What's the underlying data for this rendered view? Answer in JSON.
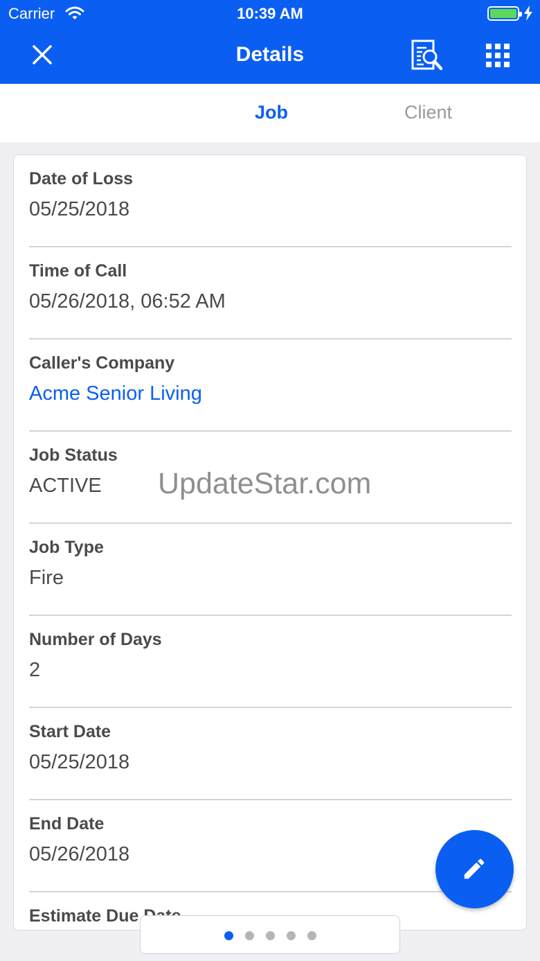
{
  "status_bar": {
    "carrier": "Carrier",
    "time": "10:39 AM"
  },
  "nav": {
    "title": "Details",
    "close_icon": "close-icon",
    "search_icon": "document-search-icon",
    "menu_icon": "grid-menu-icon"
  },
  "tabs": [
    {
      "label": "Job",
      "active": true
    },
    {
      "label": "Client",
      "active": false
    }
  ],
  "fields": [
    {
      "label": "Date of Loss",
      "value": "05/25/2018"
    },
    {
      "label": "Time of Call",
      "value": "05/26/2018, 06:52 AM"
    },
    {
      "label": "Caller's Company",
      "value": "Acme Senior Living"
    },
    {
      "label": "Job Status",
      "value": "ACTIVE"
    },
    {
      "label": "Job Type",
      "value": "Fire"
    },
    {
      "label": "Number of Days",
      "value": "2"
    },
    {
      "label": "Start Date",
      "value": "05/25/2018"
    },
    {
      "label": "End Date",
      "value": "05/26/2018"
    },
    {
      "label": "Estimate Due Date",
      "value": ""
    }
  ],
  "watermark": "UpdateStar.com",
  "fab_icon": "pencil-icon",
  "pager": {
    "count": 5,
    "active": 0
  },
  "colors": {
    "accent": "#0a5ff2",
    "battery": "#5cd85c"
  }
}
